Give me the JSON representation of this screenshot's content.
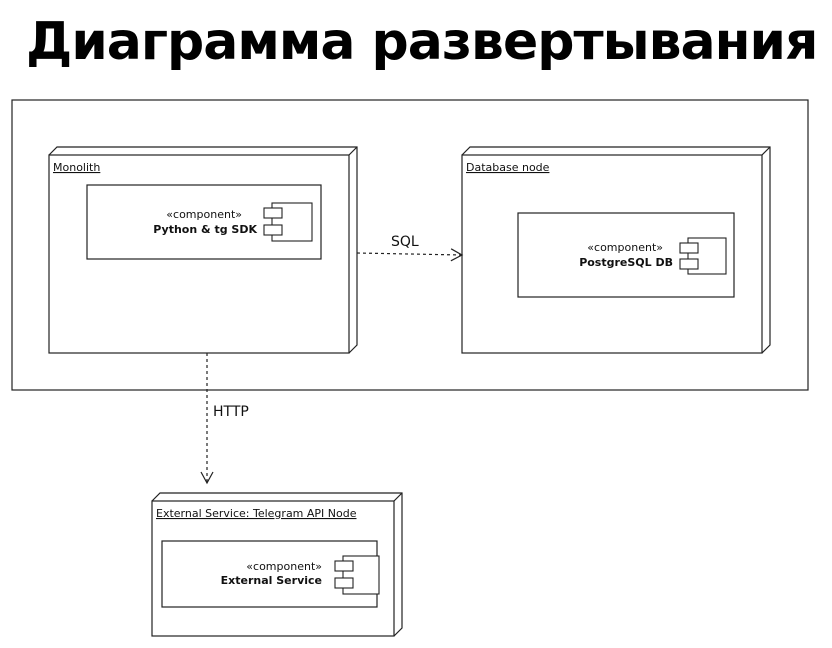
{
  "title": "Диаграмма развертывания",
  "nodes": {
    "monolith": {
      "label": "Monolith",
      "component": {
        "stereotype": "«component»",
        "name": "Python & tg SDK"
      }
    },
    "database": {
      "label": "Database node",
      "component": {
        "stereotype": "«component»",
        "name": "PostgreSQL DB"
      }
    },
    "external": {
      "label": "External Service: Telegram API Node",
      "component": {
        "stereotype": "«component»",
        "name": "External Service"
      }
    }
  },
  "edges": {
    "sql": {
      "label": "SQL"
    },
    "http": {
      "label": "HTTP"
    }
  }
}
